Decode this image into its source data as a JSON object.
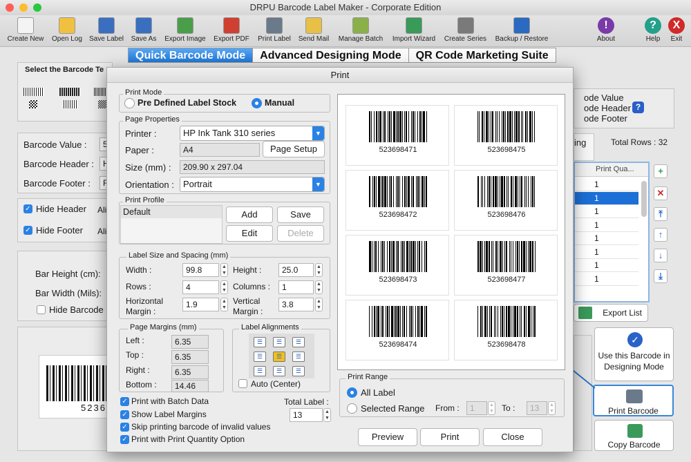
{
  "app": {
    "title": "DRPU Barcode Label Maker - Corporate Edition"
  },
  "toolbar": {
    "items": [
      {
        "label": "Create New",
        "icon": "new-doc-icon",
        "color": "#f4f4f4"
      },
      {
        "label": "Open Log",
        "icon": "folder-icon",
        "color": "#f0c040"
      },
      {
        "label": "Save Label",
        "icon": "save-icon",
        "color": "#3a6fc0"
      },
      {
        "label": "Save As",
        "icon": "save-as-icon",
        "color": "#3a6fc0"
      },
      {
        "label": "Export Image",
        "icon": "image-icon",
        "color": "#4a9e4a"
      },
      {
        "label": "Export PDF",
        "icon": "pdf-icon",
        "color": "#d04030"
      },
      {
        "label": "Print Label",
        "icon": "printer-icon",
        "color": "#6a7a8a"
      },
      {
        "label": "Send Mail",
        "icon": "mail-icon",
        "color": "#e8c048"
      },
      {
        "label": "Manage Batch",
        "icon": "batch-icon",
        "color": "#8ab04a"
      },
      {
        "label": "Import Wizard",
        "icon": "wizard-icon",
        "color": "#3a9a5a"
      },
      {
        "label": "Create Series",
        "icon": "series-icon",
        "color": "#7a7a7a"
      },
      {
        "label": "Backup / Restore",
        "icon": "backup-icon",
        "color": "#2a6ac0"
      }
    ],
    "about": "About",
    "help": "Help",
    "exit": "Exit"
  },
  "modes": [
    "Quick Barcode Mode",
    "Advanced Designing Mode",
    "QR Code Marketing Suite"
  ],
  "background": {
    "select_barcode_title": "Select the Barcode Te",
    "fields": [
      {
        "label": "Barcode Value :",
        "value": "5"
      },
      {
        "label": "Barcode Header :",
        "value": "H"
      },
      {
        "label": "Barcode Footer :",
        "value": "F"
      }
    ],
    "hide_header": "Hide Header",
    "hide_footer": "Hide Footer",
    "ali": "Ali",
    "bar_height": "Bar Height (cm):",
    "bar_width": "Bar Width (Mils):",
    "hide_barcode": "Hide Barcode",
    "sample_number": "5236",
    "right_checks": [
      "ode Value",
      "ode Header",
      "ode Footer"
    ],
    "tab_partial": "ing",
    "total_rows": "Total Rows : 32",
    "grid_header": "Print Qua...",
    "grid_rows": [
      "1",
      "1",
      "1",
      "1",
      "1",
      "1",
      "1",
      "1"
    ],
    "export_list": "Export List",
    "use_in_designing": "Use this Barcode in Designing Mode",
    "print_barcode": "Print Barcode",
    "copy_barcode": "Copy Barcode"
  },
  "dialog": {
    "title": "Print",
    "print_mode": {
      "label": "Print Mode",
      "options": [
        "Pre Defined Label Stock",
        "Manual"
      ],
      "selected": "Manual"
    },
    "page_properties": {
      "label": "Page Properties",
      "printer_label": "Printer :",
      "printer": "HP Ink Tank 310 series",
      "paper_label": "Paper :",
      "paper": "A4",
      "page_setup": "Page Setup",
      "size_label": "Size (mm) :",
      "size": "209.90 x 297.04",
      "orientation_label": "Orientation :",
      "orientation": "Portrait"
    },
    "print_profile": {
      "label": "Print Profile",
      "items": [
        "Default"
      ],
      "add": "Add",
      "save": "Save",
      "edit": "Edit",
      "delete": "Delete"
    },
    "label_size": {
      "label": "Label Size and Spacing (mm)",
      "width_label": "Width :",
      "width": "99.8",
      "height_label": "Height :",
      "height": "25.0",
      "rows_label": "Rows :",
      "rows": "4",
      "columns_label": "Columns :",
      "columns": "1",
      "hmargin_label1": "Horizontal",
      "hmargin_label2": "Margin :",
      "hmargin": "1.9",
      "vmargin_label1": "Vertical",
      "vmargin_label2": "Margin :",
      "vmargin": "3.8"
    },
    "page_margins": {
      "label": "Page Margins (mm)",
      "left_label": "Left :",
      "left": "6.35",
      "top_label": "Top :",
      "top": "6.35",
      "right_label": "Right :",
      "right": "6.35",
      "bottom_label": "Bottom :",
      "bottom": "14.46"
    },
    "label_alignments": {
      "label": "Label Alignments",
      "auto_center": "Auto (Center)"
    },
    "options": {
      "print_batch": "Print with Batch Data",
      "show_margins": "Show Label Margins",
      "skip_invalid": "Skip printing barcode of invalid values",
      "print_qty": "Print with Print Quantity Option"
    },
    "total_label": {
      "label": "Total Label :",
      "value": "13"
    },
    "print_range": {
      "label": "Print Range",
      "all": "All Label",
      "selected": "Selected Range",
      "from_label": "From :",
      "from": "1",
      "to_label": "To :",
      "to": "13"
    },
    "buttons": {
      "preview": "Preview",
      "print": "Print",
      "close": "Close"
    },
    "barcodes": [
      "523698471",
      "523698475",
      "523698472",
      "523698476",
      "523698473",
      "523698477",
      "523698474",
      "523698478"
    ]
  }
}
